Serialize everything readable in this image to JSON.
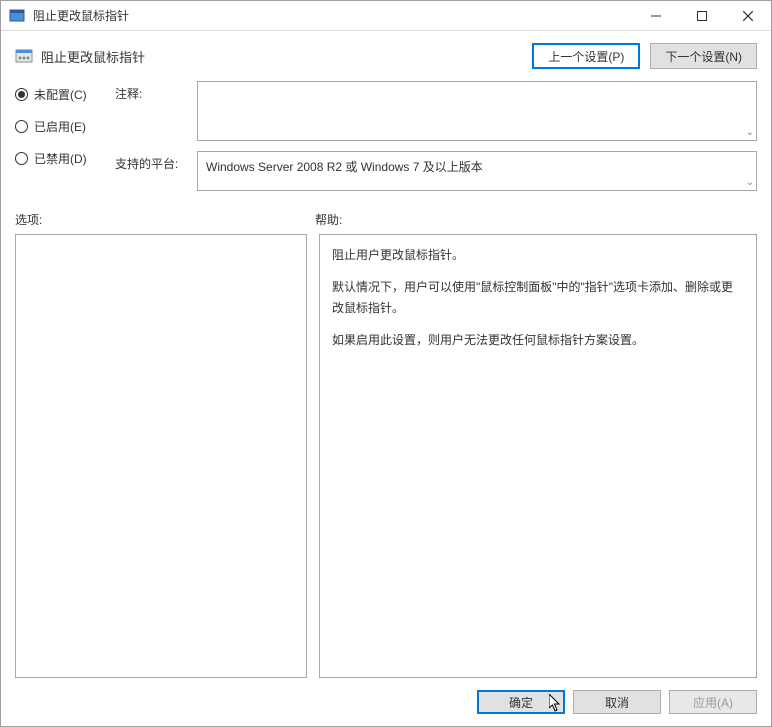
{
  "titlebar": {
    "title": "阻止更改鼠标指针"
  },
  "header": {
    "title": "阻止更改鼠标指针",
    "prev_button": "上一个设置(P)",
    "next_button": "下一个设置(N)"
  },
  "radios": {
    "not_configured": "未配置(C)",
    "enabled": "已启用(E)",
    "disabled": "已禁用(D)"
  },
  "fields": {
    "comment_label": "注释:",
    "comment_value": "",
    "supported_label": "支持的平台:",
    "supported_value": "Windows Server 2008 R2 或 Windows 7 及以上版本"
  },
  "panels": {
    "options_label": "选项:",
    "help_label": "帮助:",
    "help_p1": "阻止用户更改鼠标指针。",
    "help_p2": "默认情况下，用户可以使用\"鼠标控制面板\"中的\"指针\"选项卡添加、删除或更改鼠标指针。",
    "help_p3": "如果启用此设置，则用户无法更改任何鼠标指针方案设置。"
  },
  "footer": {
    "ok": "确定",
    "cancel": "取消",
    "apply": "应用(A)"
  }
}
